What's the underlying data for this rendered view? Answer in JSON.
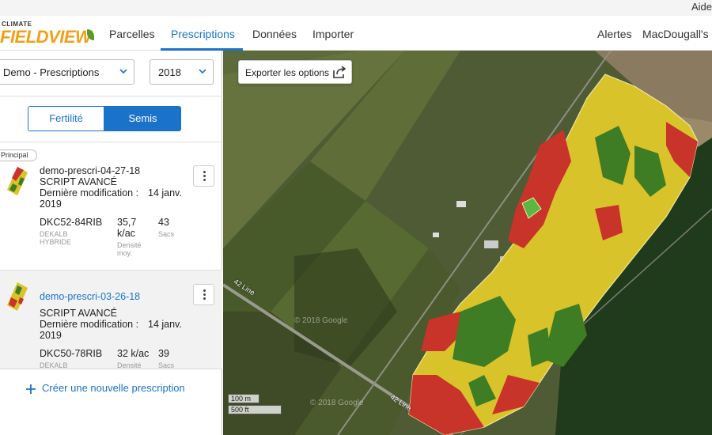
{
  "top": {
    "help_label": "Aide"
  },
  "nav": {
    "logo_small": "CLIMATE",
    "logo_main": "FIELDVIEW",
    "links": [
      {
        "label": "Parcelles",
        "active": false
      },
      {
        "label": "Prescriptions",
        "active": true
      },
      {
        "label": "Données",
        "active": false
      },
      {
        "label": "Importer",
        "active": false
      }
    ],
    "alerts_label": "Alertes",
    "account_label": "MacDougall's Co"
  },
  "panel": {
    "season_select": "Demo - Prescriptions",
    "year_select": "2018",
    "toggle": {
      "left": "Fertilité",
      "right": "Semis",
      "selected": "Semis"
    },
    "badge": "Principal",
    "prescriptions": [
      {
        "name": "demo-prescri-04-27-18",
        "type": "SCRIPT AVANCÉ",
        "modified_label": "Dernière modification :",
        "modified_date": "14 janv.",
        "modified_year": "2019",
        "hybrid": "DKC52-84RIB",
        "brand": "DEKALB",
        "brand_sub": "HYBRIDE",
        "density": "35,7",
        "density_unit": "k/ac",
        "density_label": "Densité",
        "density_label_sub": "moy.",
        "count": "43",
        "count_label": "Sacs"
      },
      {
        "name": "demo-prescri-03-26-18",
        "type": "SCRIPT AVANCÉ",
        "modified_label": "Dernière modification :",
        "modified_date": "14 janv.",
        "modified_year": "2019",
        "hybrid": "DKC50-78RIB",
        "brand": "DEKALB",
        "density": "32 k/ac",
        "density_label": "Densité",
        "count": "39",
        "count_label": "Sacs"
      }
    ],
    "create_label": "Créer une nouvelle prescription"
  },
  "map": {
    "export_label": "Exporter les options",
    "scale_m": "100 m",
    "scale_ft": "500 ft",
    "road_label_1": "42 Line",
    "road_label_2": "42 Line",
    "watermark": "© 2018 Google",
    "zone_colors": {
      "high": "#c8332a",
      "medium": "#d9c32a",
      "low": "#3f7d25"
    }
  },
  "colors": {
    "accent": "#1a73c8"
  }
}
